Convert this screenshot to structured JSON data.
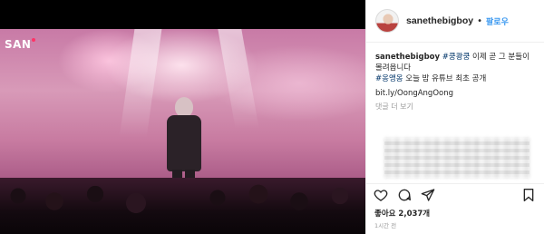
{
  "media": {
    "watermark": "SAN"
  },
  "header": {
    "username": "sanethebigboy",
    "separator": "•",
    "follow_label": "팔로우"
  },
  "caption": {
    "username": "sanethebigboy",
    "line1_tag": "#쿵쾅쿵",
    "line1_text": " 이제 곧 그 분들이",
    "line2_text": "몰려옵니다",
    "line3_tag": "#옹앵옹",
    "line3_text": " 오늘 밤 유튜브 최초 공개",
    "link": "bit.ly/OongAngOong",
    "more_comments": "댓글 더 보기"
  },
  "footer": {
    "likes": "좋아요 2,037개",
    "time": "1시간 전"
  },
  "icons": {
    "like": "heart-icon",
    "comment": "comment-icon",
    "share": "share-icon",
    "save": "bookmark-icon"
  }
}
